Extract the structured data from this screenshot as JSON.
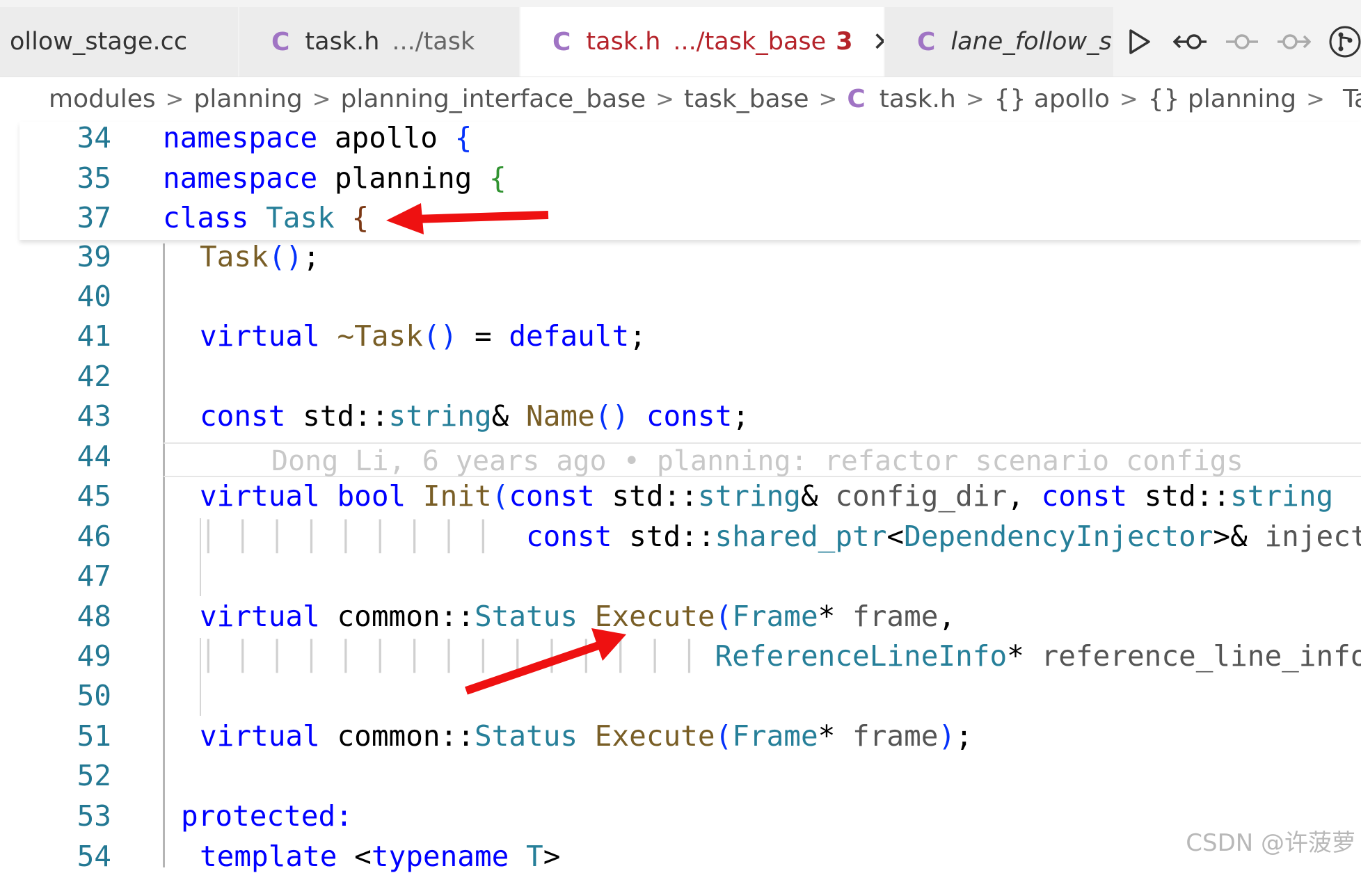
{
  "tabs": [
    {
      "name": "ollow_stage.cc",
      "desc": "",
      "badge": "",
      "icon": "c-file-icon"
    },
    {
      "name": "task.h",
      "desc": ".../task",
      "badge": "",
      "icon": "c-file-icon"
    },
    {
      "name": "task.h",
      "desc": ".../task_base",
      "badge": "3",
      "icon": "c-file-icon",
      "close": "✕"
    },
    {
      "name": "lane_follow_s",
      "desc": "",
      "badge": "",
      "icon": "c-file-icon"
    }
  ],
  "breadcrumb": {
    "items": [
      "modules",
      "planning",
      "planning_interface_base",
      "task_base",
      "task.h",
      "{} apollo",
      "{} planning",
      "Task"
    ],
    "file_icon": "C"
  },
  "code": {
    "line_numbers": [
      "34",
      "35",
      "37",
      "39",
      "40",
      "41",
      "42",
      "43",
      "44",
      "45",
      "46",
      "47",
      "48",
      "49",
      "50",
      "51",
      "52",
      "53",
      "54"
    ],
    "blame": "Dong Li, 6 years ago • planning: refactor scenario configs"
  },
  "watermark": "CSDN @许菠萝",
  "colors": {
    "keyword": "#0000ff",
    "type": "#267f99",
    "function": "#795e26",
    "line_number": "#237893",
    "arrow": "#ee1111",
    "active_tab_text": "#b5232a"
  }
}
